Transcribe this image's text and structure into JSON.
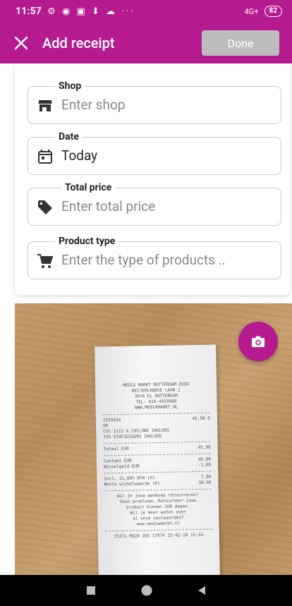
{
  "status_bar": {
    "time": "11:57",
    "notification_icons": "⚙ ◉ ▣ ⬇ ☁ ···",
    "signal": "4G+",
    "battery": "82"
  },
  "app_bar": {
    "title": "Add receipt",
    "done_label": "Done",
    "close_icon": "close-icon"
  },
  "form": {
    "shop": {
      "label": "Shop",
      "placeholder": "Enter shop",
      "icon": "store-icon"
    },
    "date": {
      "label": "Date",
      "value": "Today",
      "icon": "calendar-icon"
    },
    "total_price": {
      "label": "Total price",
      "placeholder": "Enter total price",
      "icon": "tag-icon"
    },
    "product_type": {
      "label": "Product type",
      "placeholder": "Enter the type of products ..",
      "icon": "cart-icon"
    }
  },
  "photo": {
    "fab_icon": "camera-icon",
    "receipt_lines": {
      "store": "MEDIA MARKT ROTTERDAM-ZUID",
      "street": "BEIJERLANDSE LAAN 2",
      "city": "3074 EL ROTTERDAM",
      "tel": "TEL: 010-4929900",
      "web": "WWW.MEDIAMARKT.NL",
      "item_code": "1555524",
      "item_price": "45,98 D",
      "ok": "OK",
      "item_desc1": "CVC 3115 A CHCLONE ZAKLOOS",
      "item_desc2": "735 STOFZUIGERS ZAKLOOS",
      "total_label": "Totaal EUR",
      "total_value": "45,98",
      "contant_label": "Contant EUR",
      "contant_value": "46,98",
      "change_label": "Wisselgeld EUR",
      "change_value": "-1,00",
      "incl_label": "Incl. 21,00% BTW (D)",
      "incl_value": "7,98",
      "netto_label": "Netto winkelwaarde (D)",
      "netto_value": "38,00",
      "msg1": "Wil je jouw aankoop retourneren?",
      "msg2": "Geen probleem. Retourneer jouw",
      "msg3": "product binnen 100 dagen.",
      "msg4": "Wil je meer weten over",
      "msg5": "al onze voorwaarden?",
      "msg6": "www.mediamarkt.nl",
      "footer": "25371 MO28 105 17974 25-02-20 15:33"
    }
  },
  "nav_bar": {
    "recents_icon": "square-icon",
    "home_icon": "circle-icon",
    "back_icon": "triangle-back-icon"
  },
  "colors": {
    "primary": "#b51a8e",
    "done_disabled": "#bdbdbd",
    "field_border": "#c9c9c9",
    "placeholder": "#888888"
  }
}
